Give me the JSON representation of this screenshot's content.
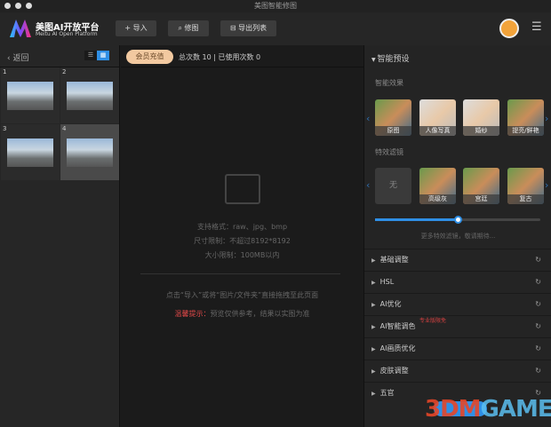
{
  "window": {
    "title": "美图智能修图"
  },
  "header": {
    "brand": "美图AI开放平台",
    "brand_sub": "Meitu AI Open Platform",
    "import": "+ 导入",
    "retouch": "⌕ 修图",
    "export": "⊟ 导出列表",
    "menu_icon": "hamburger-icon"
  },
  "left": {
    "back": "‹ 返回",
    "view_list": "☰",
    "view_grid": "▦",
    "thumbs": [
      "1",
      "2",
      "3",
      "4"
    ],
    "selected": "4"
  },
  "center": {
    "vip": "会员充值",
    "counts": "总次数 10  |  已使用次数 0",
    "formats": "支持格式：raw、jpg、bmp",
    "size": "尺寸限制：不超过8192*8192",
    "filesize": "大小限制：100MB以内",
    "drop": "点击“导入”或将“图片/文件夹”直接拖拽至此页面",
    "warn_label": "温馨提示：",
    "warn_text": "预览仅供参考，结果以实图为准"
  },
  "right": {
    "preset_title": "智能预设",
    "effects_label": "智能效果",
    "effects": [
      "原图",
      "人像写真",
      "婚纱",
      "提亮/鲜艳"
    ],
    "filters_label": "特效滤镜",
    "filters": [
      "无",
      "高级灰",
      "宫廷",
      "复古"
    ],
    "filter_strength": 0.5,
    "more": "更多特效滤镜，敬请期待...",
    "sections": [
      "基础调整",
      "HSL",
      "AI优化",
      "AI智能调色",
      "AI画质优化",
      "皮肤调整",
      "五官"
    ],
    "pro_badge": "专业版限免"
  },
  "watermark": {
    "a": "3DM",
    "b": "GAME"
  },
  "colors": {
    "accent": "#2f8fe5",
    "vip": "#f2c9a0",
    "warn": "#e04848"
  }
}
